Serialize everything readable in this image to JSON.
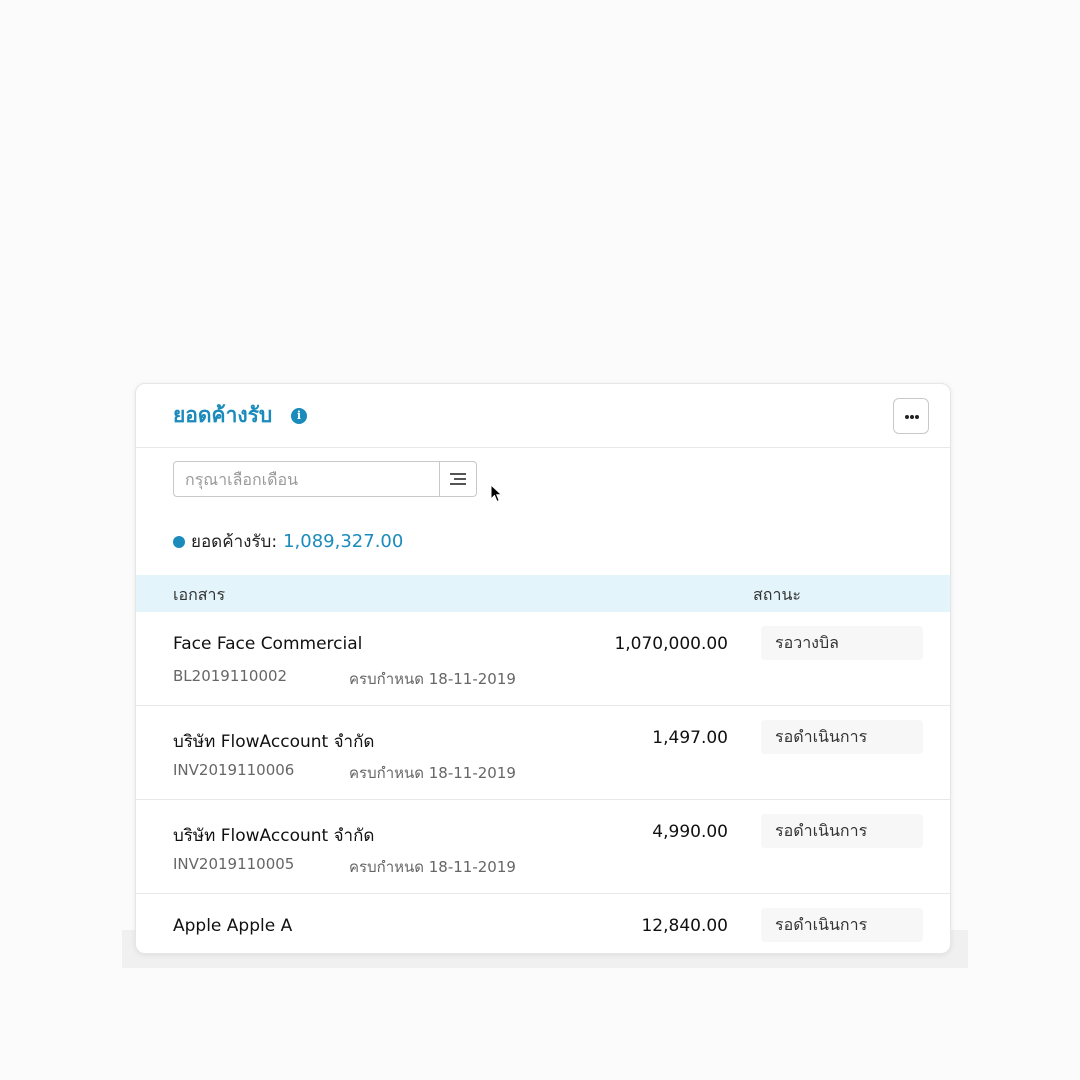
{
  "widget": {
    "title": "ยอดค้างรับ",
    "info_icon": "info-icon",
    "more_icon": "more-horizontal-icon"
  },
  "filter": {
    "month_placeholder": "กรุณาเลือกเดือน",
    "menu_icon": "menu-lines-icon"
  },
  "summary": {
    "label": "ยอดค้างรับ:",
    "amount": "1,089,327.00"
  },
  "table": {
    "headers": {
      "document": "เอกสาร",
      "status": "สถานะ"
    },
    "rows": [
      {
        "name": "Face Face Commercial",
        "doc_no": "BL2019110002",
        "due": "ครบกำหนด 18-11-2019",
        "amount": "1,070,000.00",
        "status": "รอวางบิล"
      },
      {
        "name": "บริษัท FlowAccount จำกัด",
        "doc_no": "INV2019110006",
        "due": "ครบกำหนด 18-11-2019",
        "amount": "1,497.00",
        "status": "รอดำเนินการ"
      },
      {
        "name": "บริษัท FlowAccount จำกัด",
        "doc_no": "INV2019110005",
        "due": "ครบกำหนด 18-11-2019",
        "amount": "4,990.00",
        "status": "รอดำเนินการ"
      },
      {
        "name": "Apple Apple A",
        "amount": "12,840.00",
        "status": "รอดำเนินการ"
      }
    ]
  },
  "colors": {
    "accent": "#1b8bbb",
    "header_row_bg": "#e4f4fb"
  }
}
